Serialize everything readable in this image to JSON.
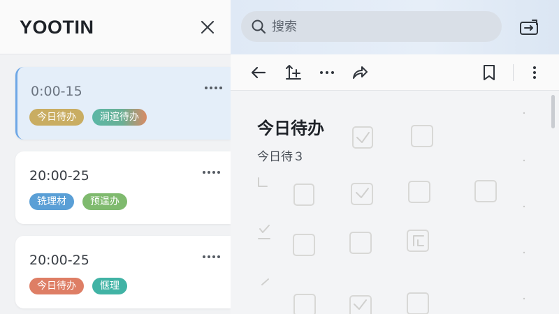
{
  "sidebar": {
    "brand": "YOOTIN",
    "cards": [
      {
        "time": "0:00-15",
        "tags": [
          {
            "label": "今日待办",
            "color": "#c9ad62"
          },
          {
            "label": "涧逭待办",
            "color": "#5bb7a6"
          }
        ]
      },
      {
        "time": "20:00-25",
        "tags": [
          {
            "label": "铣理材",
            "color": "#5a9fd6"
          },
          {
            "label": "预逞办",
            "color": "#7fba6e"
          }
        ]
      },
      {
        "time": "20:00-25",
        "tags": [
          {
            "label": "今日待办",
            "color": "#de7e65"
          },
          {
            "label": "惬理",
            "color": "#41b3a5"
          }
        ]
      }
    ]
  },
  "search": {
    "placeholder": "搜索"
  },
  "document": {
    "title": "今日待办",
    "subtitle": "今日待３"
  },
  "colors": {
    "accent": "#6ea7e6",
    "active_card": "#e4eef9"
  },
  "icons": [
    "close-icon",
    "more-horizontal-icon",
    "search-icon",
    "switch-icon",
    "arrow-left-icon",
    "text-add-icon",
    "share-icon",
    "bookmark-icon",
    "more-vertical-icon",
    "checkbox-icon"
  ]
}
